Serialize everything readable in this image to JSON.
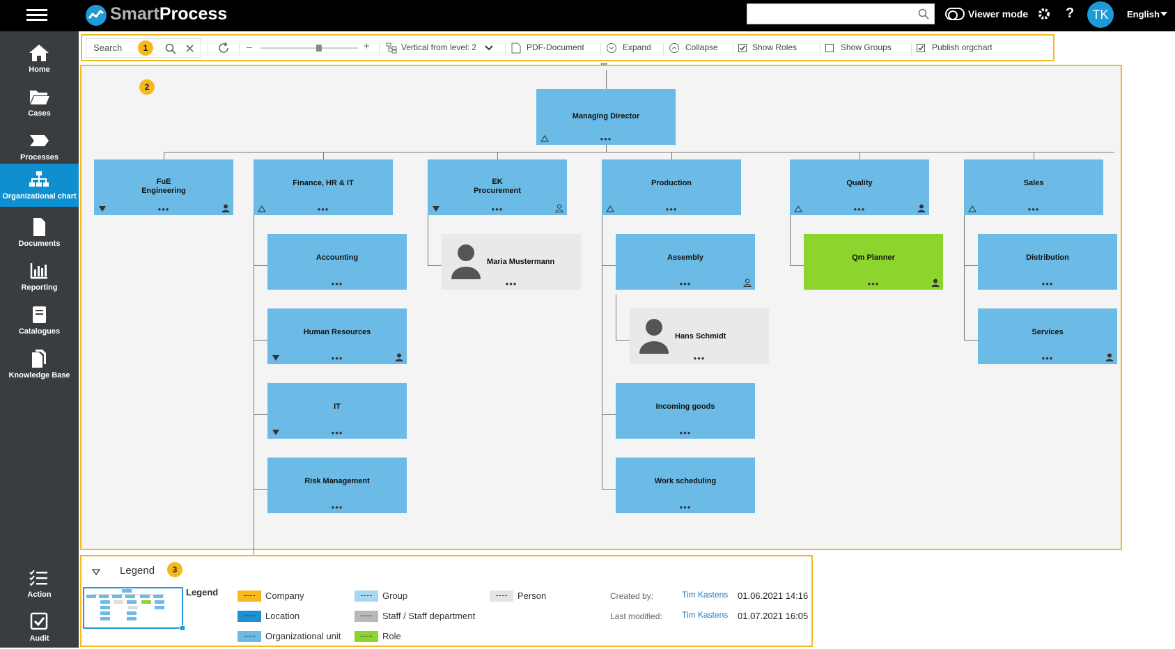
{
  "app": {
    "logo_text_a": "Smart",
    "logo_text_b": "Process",
    "viewer_mode": "Viewer mode",
    "help": "?",
    "avatar": "TK",
    "language": "English"
  },
  "sidebar": {
    "items": [
      {
        "label": "Home",
        "icon": "home-icon"
      },
      {
        "label": "Cases",
        "icon": "folder-icon"
      },
      {
        "label": "Processes",
        "icon": "process-icon"
      },
      {
        "label": "Organizational chart",
        "icon": "orgchart-icon",
        "active": true
      },
      {
        "label": "Documents",
        "icon": "document-icon"
      },
      {
        "label": "Reporting",
        "icon": "chart-icon"
      },
      {
        "label": "Catalogues",
        "icon": "catalogue-icon"
      },
      {
        "label": "Knowledge Base",
        "icon": "knowledge-icon"
      }
    ],
    "bottom": [
      {
        "label": "Action",
        "icon": "checklist-icon"
      },
      {
        "label": "Audit",
        "icon": "audit-icon"
      }
    ]
  },
  "toolbar": {
    "search_placeholder": "Search",
    "layout": "Vertical from level: 2",
    "pdf": "PDF-Document",
    "expand": "Expand",
    "collapse": "Collapse",
    "show_roles": "Show Roles",
    "show_groups": "Show Groups",
    "publish": "Publish orgchart",
    "show_roles_checked": true,
    "show_groups_checked": false,
    "publish_checked": true,
    "zoom_level": 0.6
  },
  "badges": {
    "b1": "1",
    "b2": "2",
    "b3": "3"
  },
  "orgchart": {
    "root": "Managing Director",
    "units": [
      {
        "name": "FuE\nEngineering",
        "line1": "FuE",
        "line2": "Engineering"
      },
      {
        "name": "Finance, HR & IT"
      },
      {
        "line1": "EK",
        "line2": "Procurement"
      },
      {
        "name": "Production"
      },
      {
        "name": "Quality"
      },
      {
        "name": "Sales"
      }
    ],
    "finance_children": [
      "Accounting",
      "Human Resources",
      "IT",
      "Risk Management"
    ],
    "procurement_children": [
      "Maria Mustermann"
    ],
    "production_children": [
      "Assembly",
      "Hans Schmidt",
      "Incoming goods",
      "Work scheduling"
    ],
    "quality_children": [
      "Qm Planner"
    ],
    "sales_children": [
      "Distribution",
      "Services"
    ],
    "dots": "•••",
    "top_dots": "•••"
  },
  "legend": {
    "panel_title": "Legend",
    "heading": "Legend",
    "items": [
      {
        "label": "Company",
        "color": "#f6b81c"
      },
      {
        "label": "Location",
        "color": "#1e8fd0"
      },
      {
        "label": "Organizational unit",
        "color": "#6bbbe6"
      },
      {
        "label": "Group",
        "color": "#a9d6f0"
      },
      {
        "label": "Staff / Staff department",
        "color": "#b8b8b8"
      },
      {
        "label": "Role",
        "color": "#8ed42e"
      },
      {
        "label": "Person",
        "color": "#e4e4e4"
      }
    ],
    "created_by_label": "Created by:",
    "created_by": "Tim Kastens",
    "created_at": "01.06.2021 14:16",
    "modified_label": "Last modified:",
    "modified_by": "Tim Kastens",
    "modified_at": "01.07.2021 16:05"
  }
}
